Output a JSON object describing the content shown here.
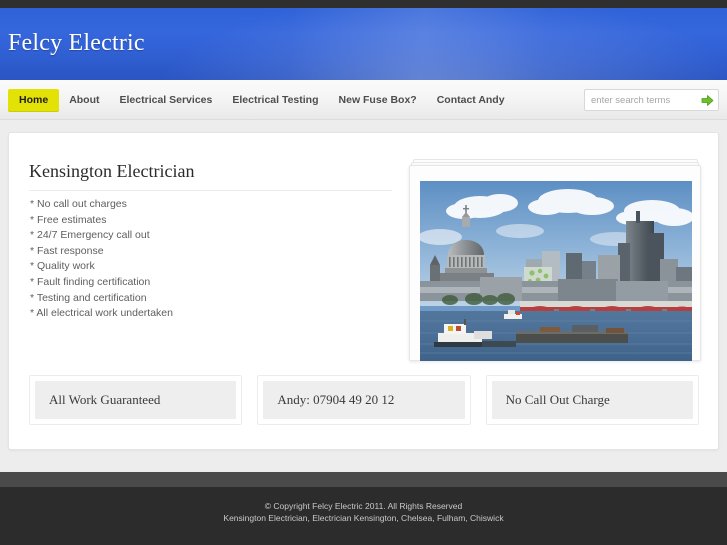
{
  "site": {
    "title": "Felcy Electric"
  },
  "nav": {
    "items": [
      {
        "label": "Home",
        "active": true
      },
      {
        "label": "About",
        "active": false
      },
      {
        "label": "Electrical Services",
        "active": false
      },
      {
        "label": "Electrical Testing",
        "active": false
      },
      {
        "label": "New Fuse Box?",
        "active": false
      },
      {
        "label": "Contact Andy",
        "active": false
      }
    ],
    "active_color": "#e2e207"
  },
  "search": {
    "value": "",
    "placeholder": "enter search terms",
    "button_icon": "arrow-right-icon",
    "button_color": "#6cc02a"
  },
  "main": {
    "heading": "Kensington Electrician",
    "features": [
      "* No call out charges",
      "* Free estimates",
      "* 24/7 Emergency call out",
      "* Fast response",
      "* Quality work",
      "* Fault finding certification",
      "* Testing and certification",
      "* All electrical work undertaken"
    ],
    "photo": {
      "alt": "London skyline over the River Thames with St Paul's Cathedral and Blackfriars Bridge"
    },
    "boxes": [
      {
        "label": "All Work Guaranteed"
      },
      {
        "label": "Andy: 07904 49 20 12"
      },
      {
        "label": "No Call Out Charge"
      }
    ]
  },
  "footer": {
    "copyright": "© Copyright Felcy Electric 2011. All Rights Reserved",
    "keywords": "Kensington Electrician, Electrician Kensington, Chelsea, Fulham, Chiswick"
  },
  "theme": {
    "header_blue": "#3566dc",
    "page_background": "#ededed",
    "footer_dark": "#2c2c2c"
  }
}
